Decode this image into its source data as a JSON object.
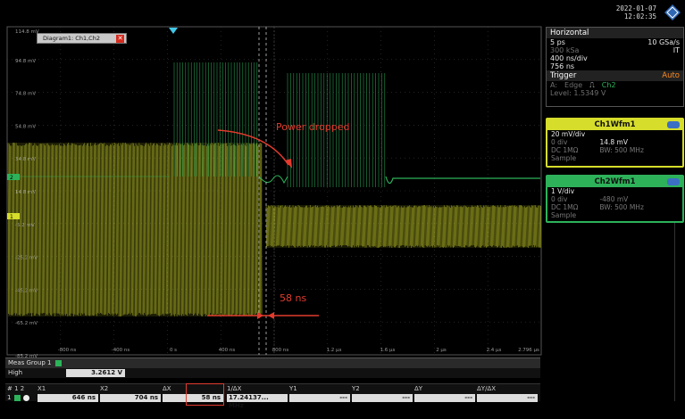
{
  "window": {
    "date": "2022-01-07",
    "time": "12:02:35",
    "diagram_tab": "Diagram1: Ch1,Ch2"
  },
  "colors": {
    "ch1": "#d6dd2b",
    "ch2": "#2db25a",
    "grid": "#3a3a3a",
    "annotation": "#e23b2e",
    "trigger_marker": "#42c8e8"
  },
  "annotations": {
    "power_dropped": "Power dropped",
    "delta_label": "58 ns"
  },
  "plot": {
    "y_labels": [
      "114.8 mV",
      "94.8 mV",
      "74.8 mV",
      "54.8 mV",
      "34.8 mV",
      "14.8 mV",
      "-5.2 mV",
      "-25.2 mV",
      "-45.2 mV",
      "-65.2 mV",
      "-85.2 mV"
    ],
    "x_labels": [
      "-800 ns",
      "-400 ns",
      "0 s",
      "400 ns",
      "800 ns",
      "1.2 µs",
      "1.6 µs",
      "2 µs",
      "2.4 µs",
      "2.796 µs"
    ],
    "ch1_marker": "1",
    "ch2_marker": "2"
  },
  "horizontal": {
    "title": "Horizontal",
    "res": "5 ps",
    "rate": "10 GSa/s",
    "length": "300 kSa",
    "mode": "IT",
    "scale": "400 ns/div",
    "acq": "756 ns"
  },
  "trigger": {
    "title": "Trigger",
    "mode": "Auto",
    "type": "Edge",
    "source": "Ch2",
    "prefix": "A:",
    "level": "Level: 1.5349 V"
  },
  "ch1": {
    "title": "Ch1Wfm1",
    "scale": "20 mV/div",
    "offset_div": "0 div",
    "offset_val": "14.8 mV",
    "coupling": "DC 1MΩ",
    "bw": "BW: 500 MHz",
    "mode": "Sample"
  },
  "ch2": {
    "title": "Ch2Wfm1",
    "scale": "1 V/div",
    "offset_div": "0 div",
    "offset_val": "-480 mV",
    "coupling": "DC 1MΩ",
    "bw": "BW: 500 MHz",
    "mode": "Sample"
  },
  "measurements": {
    "group": "Meas Group 1",
    "label": "High",
    "value": "3.2612 V"
  },
  "cursors": {
    "headers": [
      "# 1 2",
      "X1",
      "X2",
      "ΔX",
      "1/ΔX",
      "Y1",
      "Y2",
      "ΔY",
      "ΔY/ΔX"
    ],
    "index": "1",
    "x1": "646 ns",
    "x2": "704 ns",
    "dx": "58 ns",
    "inv_dx": "17.24137... MHz",
    "y1": "---",
    "y2": "---",
    "dy": "---",
    "dy_dx": "---"
  }
}
